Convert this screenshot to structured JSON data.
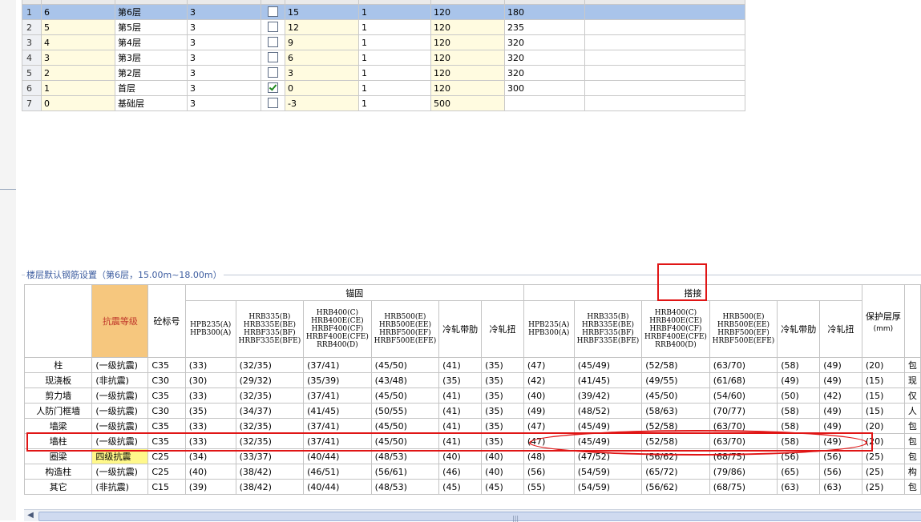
{
  "floors": [
    {
      "row": "1",
      "code": "6",
      "name": "第6层",
      "c3": "3",
      "checked": false,
      "elev": "15",
      "c6": "1",
      "c7": "120",
      "c8": "180"
    },
    {
      "row": "2",
      "code": "5",
      "name": "第5层",
      "c3": "3",
      "checked": false,
      "elev": "12",
      "c6": "1",
      "c7": "120",
      "c8": "235"
    },
    {
      "row": "3",
      "code": "4",
      "name": "第4层",
      "c3": "3",
      "checked": false,
      "elev": "9",
      "c6": "1",
      "c7": "120",
      "c8": "320"
    },
    {
      "row": "4",
      "code": "3",
      "name": "第3层",
      "c3": "3",
      "checked": false,
      "elev": "6",
      "c6": "1",
      "c7": "120",
      "c8": "320"
    },
    {
      "row": "5",
      "code": "2",
      "name": "第2层",
      "c3": "3",
      "checked": false,
      "elev": "3",
      "c6": "1",
      "c7": "120",
      "c8": "320"
    },
    {
      "row": "6",
      "code": "1",
      "name": "首层",
      "c3": "3",
      "checked": true,
      "elev": "0",
      "c6": "1",
      "c7": "120",
      "c8": "300"
    },
    {
      "row": "7",
      "code": "0",
      "name": "基础层",
      "c3": "3",
      "checked": false,
      "elev": "-3",
      "c6": "1",
      "c7": "500",
      "c8": ""
    }
  ],
  "section_title": "楼层默认钢筋设置（第6层，15.00m~18.00m）",
  "headers": {
    "anchorage": "锚固",
    "lap": "搭接",
    "seismic": "抗震等级",
    "concrete": "砼标号",
    "cover": "保护层厚",
    "cover_unit": "(mm)",
    "hpb": "HPB235(A) HPB300(A)",
    "hrb335": "HRB335(B) HRB335E(BE) HRBF335(BF) HRBF335E(BFE)",
    "hrb400": "HRB400(C) HRB400E(CE) HRBF400(CF) HRBF400E(CFE) RRB400(D)",
    "hrb500": "HRB500(E) HRB500E(EE) HRBF500(EF) HRBF500E(EFE)",
    "cold_ribbed": "冷轧带肋",
    "cold_twisted": "冷轧扭"
  },
  "rows": [
    {
      "name": "柱",
      "seismic": "(一级抗震)",
      "conc": "C35",
      "a": [
        "(33)",
        "(32/35)",
        "(37/41)",
        "(45/50)",
        "(41)",
        "(35)"
      ],
      "l": [
        "(47)",
        "(45/49)",
        "(52/58)",
        "(63/70)",
        "(58)",
        "(49)"
      ],
      "cover": "(20)",
      "extra": "包"
    },
    {
      "name": "现浇板",
      "seismic": "(非抗震)",
      "conc": "C30",
      "a": [
        "(30)",
        "(29/32)",
        "(35/39)",
        "(43/48)",
        "(35)",
        "(35)"
      ],
      "l": [
        "(42)",
        "(41/45)",
        "(49/55)",
        "(61/68)",
        "(49)",
        "(49)"
      ],
      "cover": "(15)",
      "extra": "现"
    },
    {
      "name": "剪力墙",
      "seismic": "(一级抗震)",
      "conc": "C35",
      "a": [
        "(33)",
        "(32/35)",
        "(37/41)",
        "(45/50)",
        "(41)",
        "(35)"
      ],
      "l": [
        "(40)",
        "(39/42)",
        "(45/50)",
        "(54/60)",
        "(50)",
        "(42)"
      ],
      "cover": "(15)",
      "extra": "仅"
    },
    {
      "name": "人防门框墙",
      "seismic": "(一级抗震)",
      "conc": "C30",
      "a": [
        "(35)",
        "(34/37)",
        "(41/45)",
        "(50/55)",
        "(41)",
        "(35)"
      ],
      "l": [
        "(49)",
        "(48/52)",
        "(58/63)",
        "(70/77)",
        "(58)",
        "(49)"
      ],
      "cover": "(15)",
      "extra": "人"
    },
    {
      "name": "墙梁",
      "seismic": "(一级抗震)",
      "conc": "C35",
      "a": [
        "(33)",
        "(32/35)",
        "(37/41)",
        "(45/50)",
        "(41)",
        "(35)"
      ],
      "l": [
        "(47)",
        "(45/49)",
        "(52/58)",
        "(63/70)",
        "(58)",
        "(49)"
      ],
      "cover": "(20)",
      "extra": "包"
    },
    {
      "name": "墙柱",
      "seismic": "(一级抗震)",
      "conc": "C35",
      "a": [
        "(33)",
        "(32/35)",
        "(37/41)",
        "(45/50)",
        "(41)",
        "(35)"
      ],
      "l": [
        "(47)",
        "(45/49)",
        "(52/58)",
        "(63/70)",
        "(58)",
        "(49)"
      ],
      "cover": "(20)",
      "extra": "包"
    },
    {
      "name": "圈梁",
      "seismic": "四级抗震",
      "conc": "C25",
      "a": [
        "(34)",
        "(33/37)",
        "(40/44)",
        "(48/53)",
        "(40)",
        "(40)"
      ],
      "l": [
        "(48)",
        "(47/52)",
        "(56/62)",
        "(68/75)",
        "(56)",
        "(56)"
      ],
      "cover": "(25)",
      "extra": "包",
      "highlight": true
    },
    {
      "name": "构造柱",
      "seismic": "(一级抗震)",
      "conc": "C25",
      "a": [
        "(40)",
        "(38/42)",
        "(46/51)",
        "(56/61)",
        "(46)",
        "(40)"
      ],
      "l": [
        "(56)",
        "(54/59)",
        "(65/72)",
        "(79/86)",
        "(65)",
        "(56)"
      ],
      "cover": "(25)",
      "extra": "构"
    },
    {
      "name": "其它",
      "seismic": "(非抗震)",
      "conc": "C15",
      "a": [
        "(39)",
        "(38/42)",
        "(40/44)",
        "(48/53)",
        "(45)",
        "(45)"
      ],
      "l": [
        "(55)",
        "(54/59)",
        "(56/62)",
        "(68/75)",
        "(63)",
        "(63)"
      ],
      "cover": "(25)",
      "extra": "包"
    }
  ],
  "colors": {
    "annotation": "#e01515",
    "selected_row": "#a9c4ea",
    "seismic_header": "#f6c77e",
    "edit_cell": "#fff88a"
  },
  "icons": {
    "scroll_left": "chevron-left-icon",
    "scroll_grip": "grip-icon"
  }
}
